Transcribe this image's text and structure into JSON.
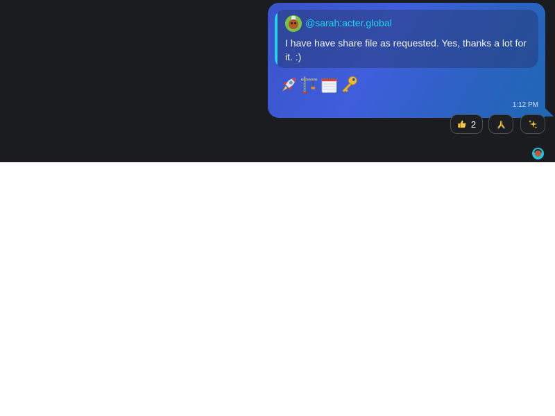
{
  "message": {
    "reply": {
      "author": "@sarah:acter.global",
      "text": "I have have share file as requested. Yes, thanks a lot for it. :)",
      "avatar_icon": "user-avatar-icon"
    },
    "emojis": [
      {
        "name": "rocket-emoji-icon"
      },
      {
        "name": "construction-crane-emoji-icon"
      },
      {
        "name": "spiral-calendar-emoji-icon"
      },
      {
        "name": "key-emoji-icon"
      }
    ],
    "timestamp": "1:12 PM"
  },
  "reactions": [
    {
      "icon": "thumbs-up-icon",
      "count": "2"
    },
    {
      "icon": "folded-hands-icon",
      "count": ""
    },
    {
      "icon": "sparkles-icon",
      "count": ""
    }
  ],
  "colors": {
    "background": "#1a1c1f",
    "bubble_start": "#3a52c8",
    "bubble_end": "#1f68b4",
    "accent": "#22d3ee",
    "reaction_border": "#4a4d55"
  }
}
